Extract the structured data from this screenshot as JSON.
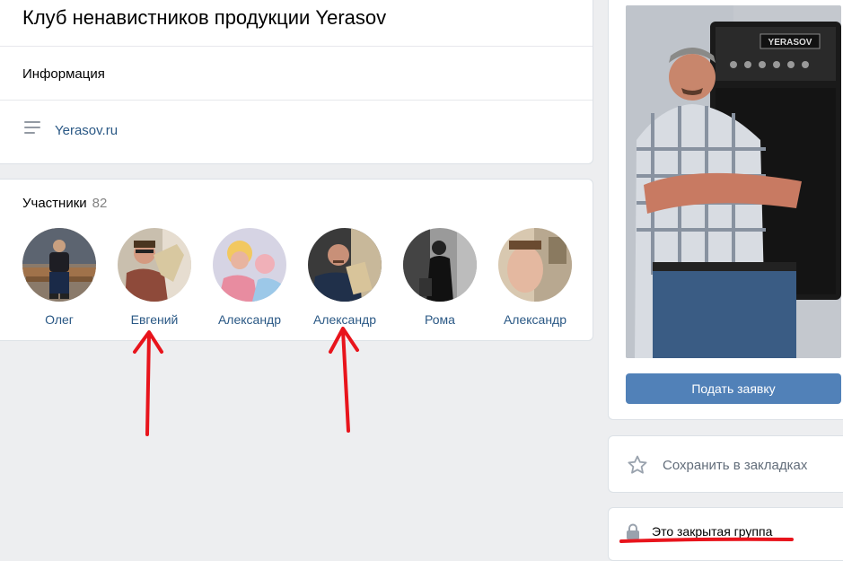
{
  "group": {
    "title": "Клуб ненавистников продукции Yerasov",
    "info_label": "Информация",
    "website": "Yerasov.ru"
  },
  "members": {
    "title": "Участники",
    "count": "82",
    "items": [
      {
        "name": "Олег"
      },
      {
        "name": "Евгений"
      },
      {
        "name": "Александр"
      },
      {
        "name": "Александр"
      },
      {
        "name": "Рома"
      },
      {
        "name": "Александр"
      }
    ]
  },
  "sidebar": {
    "cover_amp_brand": "YERASOV",
    "apply_label": "Подать заявку",
    "bookmark_label": "Сохранить в закладках",
    "closed_group_label": "Это закрытая группа"
  },
  "colors": {
    "accent": "#5181b8",
    "link": "#2a5885",
    "annotation": "#e8141c"
  }
}
